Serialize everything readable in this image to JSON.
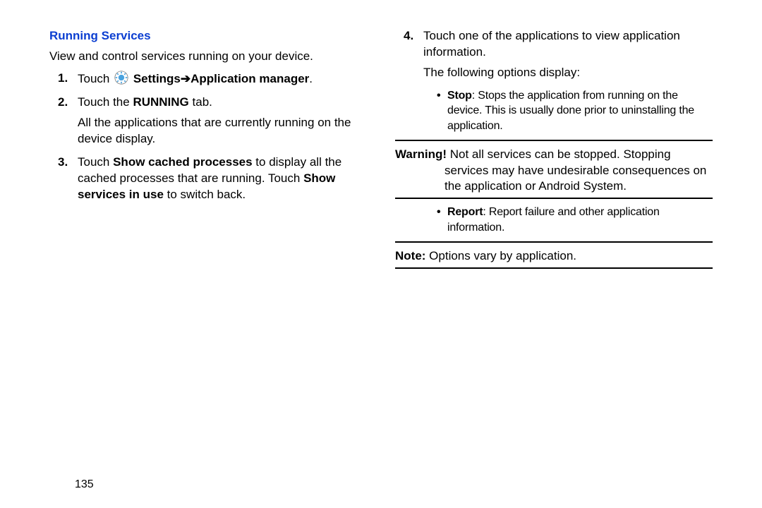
{
  "heading": "Running Services",
  "intro": "View and control services running on your device.",
  "steps": {
    "s1_prefix": "Touch ",
    "s1_settings": "Settings",
    "s1_arrow": " ➔ ",
    "s1_appmgr": "Application manager",
    "s1_period": ".",
    "s2_prefix": "Touch the ",
    "s2_running": "RUNNING",
    "s2_suffix": " tab.",
    "s2_sub": "All the applications that are currently running on the device display.",
    "s3_prefix": "Touch ",
    "s3_show_cached": "Show cached processes",
    "s3_mid": " to display all the cached processes that are running. Touch ",
    "s3_show_services": "Show services in use",
    "s3_suffix": " to switch back.",
    "s4_line1": "Touch one of the applications to view application information.",
    "s4_line2": "The following options display:"
  },
  "options": {
    "stop_label": "Stop",
    "stop_text": ": Stops the application from running on the device. This is usually done prior to uninstalling the application.",
    "report_label": "Report",
    "report_text": ": Report failure and other application information."
  },
  "warning_label": "Warning!",
  "warning_text": " Not all services can be stopped. Stopping services may have undesirable consequences on the application or Android System.",
  "note_label": "Note:",
  "note_text": " Options vary by application.",
  "page_number": "135"
}
